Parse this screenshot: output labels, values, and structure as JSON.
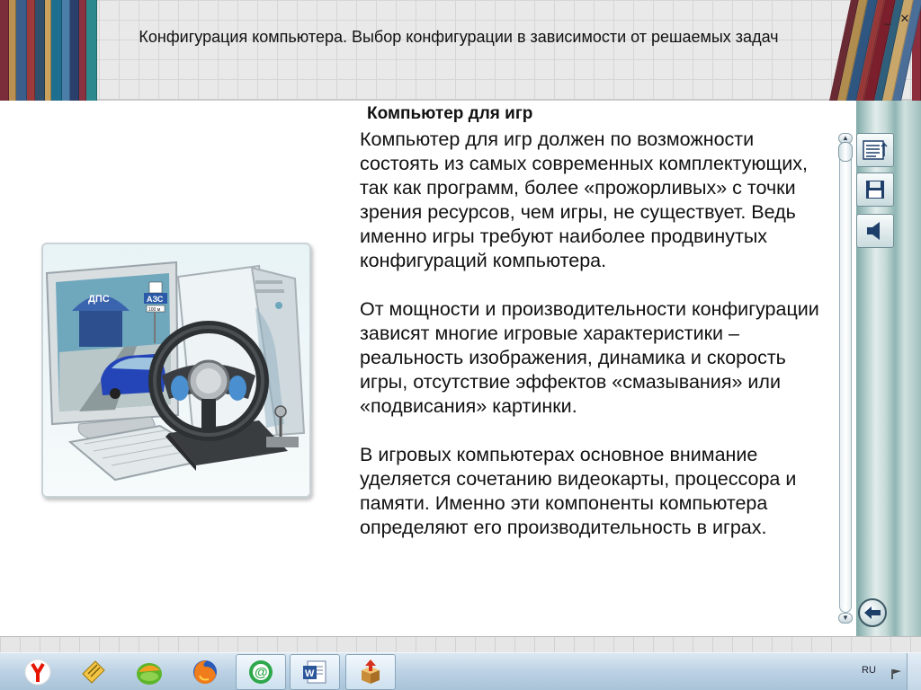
{
  "window": {
    "title": "Конфигурация компьютера. Выбор конфигурации в зависимости от решаемых задач",
    "minimize_glyph": "_",
    "close_glyph": "✕"
  },
  "content": {
    "section_title": "Компьютер для игр",
    "paragraphs": [
      "Компьютер для игр должен по возможности состоять из самых современных комплектующих, так как программ, более «прожорливых» с точки зрения ресурсов, чем игры, не существует. Ведь именно игры требуют наиболее продвинутых конфигураций компьютера.",
      "От мощности и производительности конфигурации зависят многие игровые характеристики – реальность изображения, динамика и скорость игры, отсутствие эффектов «смазывания» или «подвисания» картинки.",
      "В игровых компьютерах основное внимание уделяется сочетанию видеокарты, процессора и памяти. Именно эти компоненты компьютера определяют его производительность в играх."
    ],
    "illustration": {
      "sign_dps": "ДПС",
      "sign_azs": "АЗС",
      "sign_small": "100 м"
    }
  },
  "side_panel": {
    "buttons": [
      "contents-icon",
      "save-icon",
      "sound-icon"
    ],
    "back": "back-arrow-icon"
  },
  "taskbar": {
    "items": [
      "yandex-browser-icon",
      "notes-icon",
      "green-app-icon",
      "firefox-icon",
      "mail-agent-icon",
      "word-icon",
      "package-installer-icon"
    ],
    "active_items": [
      "mail-agent-icon",
      "word-icon",
      "package-installer-icon"
    ],
    "language": "RU"
  },
  "colors": {
    "header_bg": "#e9e9e9",
    "panel_teal": "#9fbfbd",
    "taskbar_blue": "#bcd2e4"
  }
}
